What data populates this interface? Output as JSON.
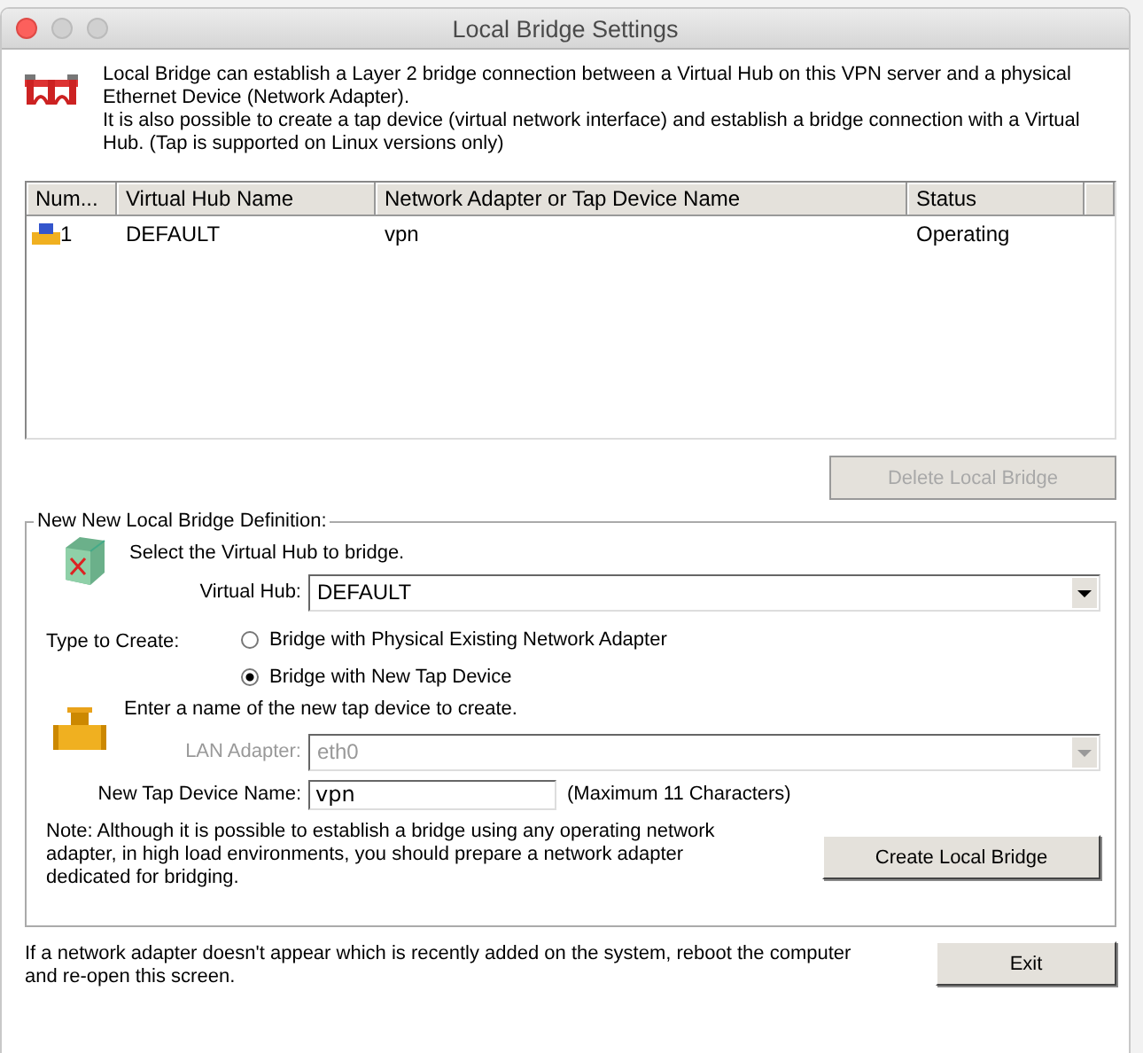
{
  "window": {
    "title": "Local Bridge Settings"
  },
  "intro": [
    "Local Bridge can establish a Layer 2 bridge connection between a Virtual Hub on this VPN server and a physical Ethernet Device (Network Adapter).",
    "It is also possible to create a tap device (virtual network interface) and establish a bridge connection with a Virtual Hub. (Tap is supported on Linux versions only)"
  ],
  "table": {
    "columns": [
      "Num...",
      "Virtual Hub Name",
      "Network Adapter or Tap Device Name",
      "Status"
    ],
    "rows": [
      {
        "cells": [
          "1",
          "DEFAULT",
          "vpn",
          "Operating"
        ],
        "selected": false
      }
    ]
  },
  "delete_button": {
    "label": "Delete Local Bridge",
    "disabled": true
  },
  "definition": {
    "title": "New New Local Bridge Definition:",
    "hub_prompt": "Select the Virtual Hub to bridge.",
    "hub_label": "Virtual Hub:",
    "hub_value": "DEFAULT",
    "type_label": "Type to Create:",
    "types": [
      {
        "label": "Bridge with Physical Existing Network Adapter",
        "selected": false
      },
      {
        "label": "Bridge with New Tap Device",
        "selected": true
      }
    ],
    "tap_prompt": "Enter a name of the new tap device to create.",
    "lan_label": "LAN Adapter:",
    "lan_value": "eth0",
    "lan_disabled": true,
    "tap_label": "New Tap Device Name:",
    "tap_value": "vpn",
    "tap_hint": "(Maximum 11 Characters)",
    "note": "Note: Although it is possible to establish a bridge using any operating network adapter, in high load environments, you should prepare a network adapter dedicated for bridging.",
    "create_button": "Create Local Bridge"
  },
  "footer": {
    "note": "If a network adapter doesn't appear which is recently added on the system, reboot the computer and re-open this screen.",
    "exit_button": "Exit"
  }
}
